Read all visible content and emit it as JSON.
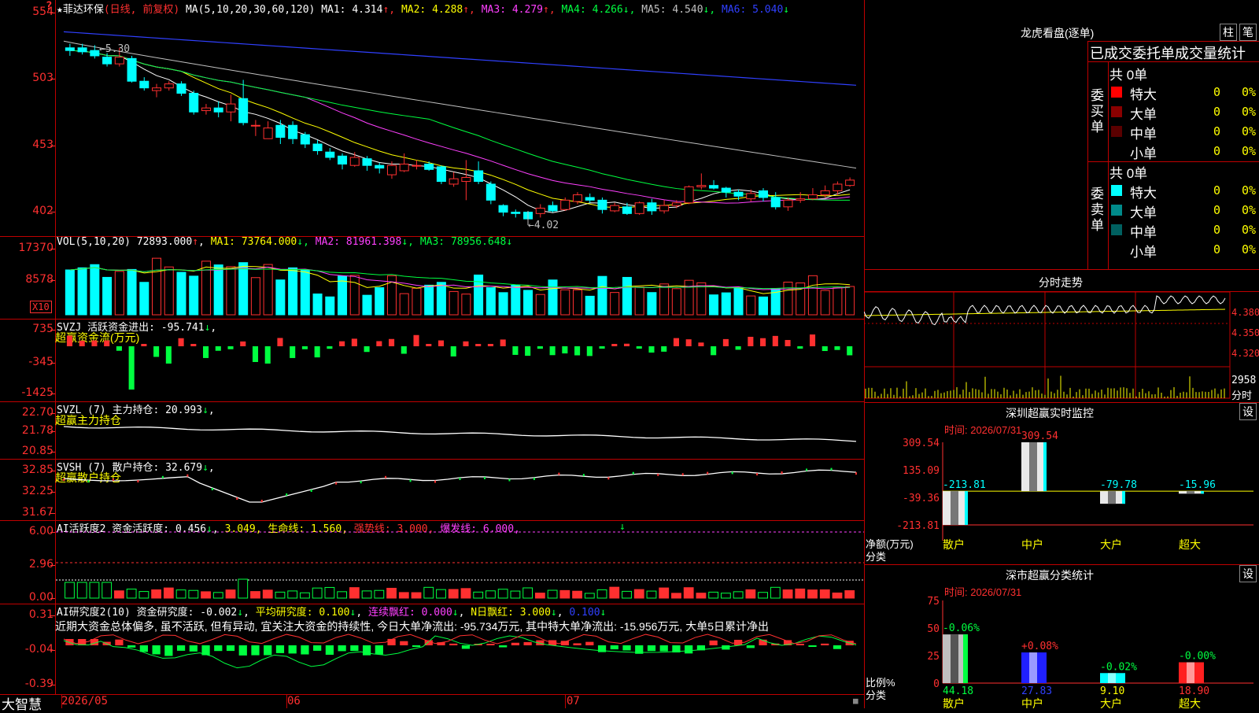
{
  "stock": {
    "name": "菲达环保",
    "period": "(日线, 前复权)",
    "ma_label": "MA(5,10,20,30,60,120)",
    "ma": [
      {
        "label": "MA1:",
        "value": "4.314",
        "arrow": "↑",
        "color": "#ffffff"
      },
      {
        "label": "MA2:",
        "value": "4.288",
        "arrow": "↑",
        "color": "#ffff00"
      },
      {
        "label": "MA3:",
        "value": "4.279",
        "arrow": "↑",
        "color": "#ff40ff"
      },
      {
        "label": "MA4:",
        "value": "4.266",
        "arrow": "↓",
        "color": "#00ff40"
      },
      {
        "label": "MA5:",
        "value": "4.540",
        "arrow": "↓",
        "color": "#c0c0c0"
      },
      {
        "label": "MA6:",
        "value": "5.040",
        "arrow": "↓",
        "color": "#3040ff"
      }
    ],
    "price_axis": [
      "554",
      "503",
      "453",
      "402"
    ],
    "hi_label": "5.30",
    "lo_label": "4.02"
  },
  "vol": {
    "header_name": "VOL(5,10,20)",
    "header_value": "72893.000",
    "ma": [
      {
        "label": "MA1:",
        "value": "73764.000",
        "color": "#ffff00"
      },
      {
        "label": "MA2:",
        "value": "81961.398",
        "color": "#ff40ff"
      },
      {
        "label": "MA3:",
        "value": "78956.648",
        "color": "#00ff40"
      }
    ],
    "axis": [
      "17370",
      "8578"
    ],
    "x10": "X10"
  },
  "svzj": {
    "header": "SVZJ  活跃资金进出: -95.741",
    "subtitle": "超赢资金流(万元)",
    "axis": [
      "735",
      "-345",
      "-1425"
    ]
  },
  "svzl": {
    "header": "SVZL (7) 主力持仓: 20.993",
    "subtitle": "超赢主力持仓",
    "axis": [
      "22.70",
      "21.78",
      "20.85"
    ]
  },
  "svsh": {
    "header": "SVSH (7) 散户持仓: 32.679",
    "subtitle": "超赢散户持仓",
    "axis": [
      "32.85",
      "32.25",
      "31.67"
    ]
  },
  "ai1": {
    "header_a": "AI活跃度2 资金活跃度: 0.456",
    "header_b": "3.049, 生命线: 1.560,",
    "header_c": "强势线: 3.000,",
    "header_d": "爆发线: 6.000,",
    "axis": [
      "6.00",
      "2.96",
      "0.00"
    ]
  },
  "ai2": {
    "header_a": "AI研究度2(10) 资金研究度: -0.002",
    "header_b": "平均研究度: 0.100",
    "header_c": "连续飘红: 0.000",
    "header_d": "N日飘红: 3.000",
    "header_e": "0.100",
    "text": "近期大资金总体偏多, 虽不活跃, 但有异动, 宜关注大资金的持续性, 今日大单净流出: -95.734万元, 其中特大单净流出: -15.956万元, 大单5日累计净出",
    "axis": [
      "0.31",
      "-0.04",
      "-0.39"
    ]
  },
  "bottom": {
    "brand": "大智慧",
    "dates": [
      "2026/05",
      "06",
      "07"
    ]
  },
  "right": {
    "lhb_title": "龙虎看盘(逐单)",
    "btn_zhu": "柱",
    "btn_bi": "笔",
    "tabs": "已成交委托单成交量统计",
    "buy_total": "共 0单",
    "buy_label": "委买单",
    "sell_total": "共 0单",
    "sell_label": "委卖单",
    "rows": [
      {
        "name": "特大",
        "count": "0",
        "pct": "0%"
      },
      {
        "name": "大单",
        "count": "0",
        "pct": "0%"
      },
      {
        "name": "中单",
        "count": "0",
        "pct": "0%"
      },
      {
        "name": "小单",
        "count": "0",
        "pct": "0%"
      }
    ],
    "fenshi_title": "分时走势",
    "fenshi_axis": [
      "4.380",
      "4.350",
      "4.320"
    ],
    "fenshi_vol": "2958",
    "fenshi_unit": "分时",
    "sz_title": "深圳超赢实时监控",
    "sz_btn": "设",
    "sz_time": "时间: 2026/07/31",
    "sz_axis": [
      "309.54",
      "135.09",
      "-39.36",
      "-213.81"
    ],
    "sz_ylabel_a": "净额(万元)",
    "sz_ylabel_b": "分类",
    "sc_title": "深市超赢分类统计",
    "sc_btn": "设",
    "sc_time": "时间: 2026/07/31",
    "sc_axis": [
      "75",
      "50",
      "25",
      "0"
    ],
    "sc_ylabel_a": "比例%",
    "sc_ylabel_b": "分类"
  },
  "chart_data": [
    {
      "type": "bar",
      "title": "深圳超赢实时监控",
      "categories": [
        "散户",
        "中户",
        "大户",
        "超大"
      ],
      "values": [
        -213.81,
        309.54,
        -79.78,
        -15.96
      ],
      "labels": [
        "-213.81",
        "309.54",
        "-79.78",
        "-15.96"
      ],
      "ylim": [
        -213.81,
        309.54
      ]
    },
    {
      "type": "bar",
      "title": "深市超赢分类统计",
      "categories": [
        "散户",
        "中户",
        "大户",
        "超大"
      ],
      "values": [
        44.18,
        27.83,
        9.1,
        18.9
      ],
      "value_labels": [
        "44.18",
        "27.83",
        "9.10",
        "18.90"
      ],
      "changes": [
        "-0.06%",
        "+0.08%",
        "-0.02%",
        "-0.00%"
      ],
      "colors": [
        "#c0c0c0",
        "#2020ff",
        "#00ffff",
        "#ff2020"
      ],
      "ylim": [
        0,
        75
      ]
    },
    {
      "type": "line",
      "title": "菲达环保 日线",
      "x_ticks": [
        "2026/05",
        "06",
        "07"
      ],
      "candles": [
        [
          5.3,
          5.28,
          5.33,
          5.24
        ],
        [
          5.3,
          5.27,
          5.33,
          5.25
        ],
        [
          5.28,
          5.24,
          5.32,
          5.22
        ],
        [
          5.23,
          5.18,
          5.26,
          5.16
        ],
        [
          5.18,
          5.23,
          5.3,
          5.16
        ],
        [
          5.22,
          5.05,
          5.24,
          5.04
        ],
        [
          5.05,
          5.0,
          5.08,
          4.98
        ],
        [
          4.98,
          5.0,
          5.03,
          4.93
        ],
        [
          5.0,
          5.03,
          5.05,
          4.98
        ],
        [
          5.03,
          4.96,
          5.05,
          4.94
        ],
        [
          4.96,
          4.82,
          4.98,
          4.8
        ],
        [
          4.83,
          4.85,
          4.88,
          4.8
        ],
        [
          4.85,
          4.82,
          4.9,
          4.78
        ],
        [
          4.82,
          4.88,
          4.95,
          4.75
        ],
        [
          4.92,
          4.74,
          5.06,
          4.72
        ],
        [
          4.72,
          4.72,
          4.76,
          4.64
        ],
        [
          4.62,
          4.7,
          4.75,
          4.62
        ],
        [
          4.72,
          4.63,
          4.76,
          4.58
        ],
        [
          4.72,
          4.62,
          4.75,
          4.58
        ],
        [
          4.65,
          4.58,
          4.67,
          4.55
        ],
        [
          4.58,
          4.53,
          4.61,
          4.5
        ],
        [
          4.52,
          4.48,
          4.55,
          4.46
        ],
        [
          4.49,
          4.43,
          4.51,
          4.39
        ],
        [
          4.42,
          4.48,
          4.52,
          4.41
        ],
        [
          4.47,
          4.42,
          4.49,
          4.38
        ],
        [
          4.42,
          4.4,
          4.44,
          4.36
        ],
        [
          4.35,
          4.42,
          4.45,
          4.32
        ],
        [
          4.38,
          4.43,
          4.51,
          4.37
        ],
        [
          4.42,
          4.42,
          4.46,
          4.39
        ],
        [
          4.43,
          4.39,
          4.45,
          4.38
        ],
        [
          4.41,
          4.3,
          4.42,
          4.28
        ],
        [
          4.28,
          4.32,
          4.37,
          4.26
        ],
        [
          4.3,
          4.33,
          4.46,
          4.16
        ],
        [
          4.38,
          4.3,
          4.45,
          4.28
        ],
        [
          4.28,
          4.16,
          4.3,
          4.13
        ],
        [
          4.12,
          4.07,
          4.13,
          4.04
        ],
        [
          4.07,
          4.06,
          4.09,
          4.03
        ],
        [
          4.07,
          4.02,
          4.08,
          4.02
        ],
        [
          4.06,
          4.1,
          4.13,
          4.03
        ],
        [
          4.12,
          4.08,
          4.15,
          4.07
        ],
        [
          4.09,
          4.16,
          4.18,
          4.08
        ],
        [
          4.15,
          4.2,
          4.22,
          4.13
        ],
        [
          4.18,
          4.16,
          4.21,
          4.14
        ],
        [
          4.16,
          4.09,
          4.18,
          4.06
        ],
        [
          4.08,
          4.12,
          4.14,
          4.07
        ],
        [
          4.11,
          4.06,
          4.14,
          4.05
        ],
        [
          4.06,
          4.14,
          4.15,
          4.05
        ],
        [
          4.14,
          4.08,
          4.17,
          4.05
        ],
        [
          4.08,
          4.12,
          4.16,
          4.06
        ],
        [
          4.12,
          4.14,
          4.16,
          4.1
        ],
        [
          4.14,
          4.26,
          4.27,
          4.13
        ],
        [
          4.26,
          4.27,
          4.36,
          4.24
        ],
        [
          4.27,
          4.25,
          4.31,
          4.24
        ],
        [
          4.25,
          4.22,
          4.26,
          4.18
        ],
        [
          4.22,
          4.19,
          4.24,
          4.16
        ],
        [
          4.17,
          4.21,
          4.24,
          4.15
        ],
        [
          4.23,
          4.18,
          4.25,
          4.15
        ],
        [
          4.18,
          4.11,
          4.22,
          4.09
        ],
        [
          4.11,
          4.16,
          4.18,
          4.08
        ],
        [
          4.16,
          4.17,
          4.22,
          4.14
        ],
        [
          4.17,
          4.2,
          4.25,
          4.16
        ],
        [
          4.2,
          4.23,
          4.27,
          4.18
        ],
        [
          4.23,
          4.28,
          4.3,
          4.2
        ],
        [
          4.27,
          4.31,
          4.33,
          4.26
        ]
      ]
    }
  ]
}
